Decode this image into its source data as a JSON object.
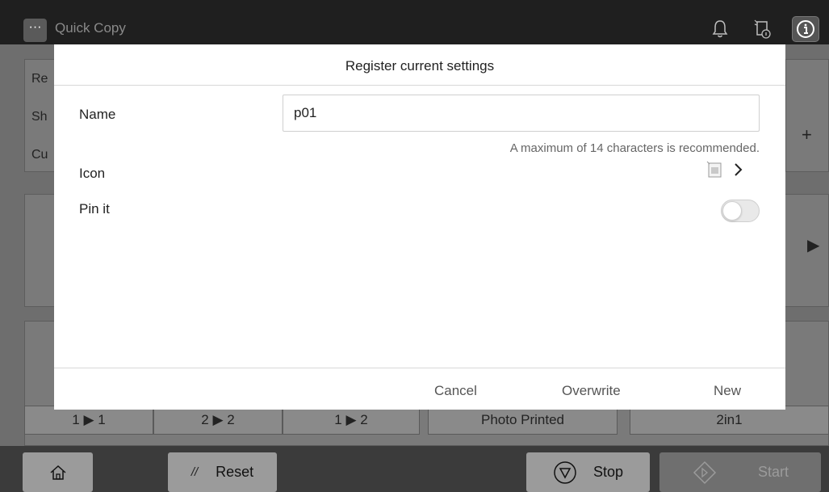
{
  "header": {
    "menu_label": "···",
    "title": "Quick Copy"
  },
  "background": {
    "list_items": [
      "Re",
      "Sh",
      "Cu"
    ],
    "plus_label": "+",
    "duplex_labels": [
      "1 ▶ 1",
      "2 ▶ 2",
      "1 ▶ 2"
    ],
    "photo_label": "Photo Printed",
    "layout_label": "2in1"
  },
  "dialog": {
    "title": "Register current settings",
    "name_label": "Name",
    "name_value": "p01",
    "hint": "A maximum of 14 characters is recommended.",
    "icon_label": "Icon",
    "pin_label": "Pin it",
    "pin_state": "off",
    "cancel_label": "Cancel",
    "overwrite_label": "Overwrite",
    "new_label": "New"
  },
  "footer": {
    "reset_label": "Reset",
    "stop_label": "Stop",
    "start_label": "Start"
  }
}
